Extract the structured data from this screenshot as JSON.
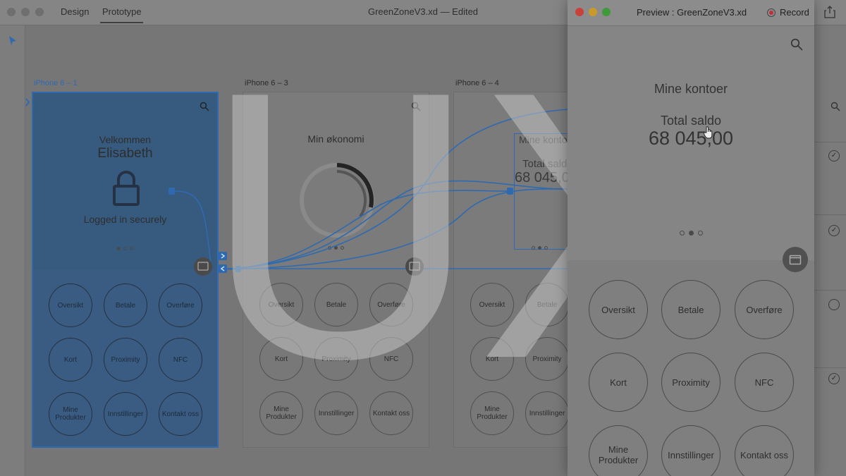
{
  "titlebar": {
    "tabs": [
      "Design",
      "Prototype"
    ],
    "active_tab": "Prototype",
    "document_title": "GreenZoneV3.xd — Edited"
  },
  "artboards": [
    {
      "label": "iPhone 6 – 1",
      "greeting": "Velkommen",
      "name": "Elisabeth",
      "status": "Logged in securely",
      "selected": true
    },
    {
      "label": "iPhone 6 – 3",
      "heading": "Min økonomi"
    },
    {
      "label": "iPhone 6 – 4",
      "heading": "Mine kontoer",
      "balance_label": "Total saldo",
      "balance_value": "68 045,00"
    }
  ],
  "menu_buttons": [
    [
      "Oversikt",
      "Betale",
      "Overføre"
    ],
    [
      "Kort",
      "Proximity",
      "NFC"
    ],
    [
      "Mine Produkter",
      "Innstillinger",
      "Kontakt oss"
    ]
  ],
  "overlay": {
    "text": "UX"
  },
  "preview": {
    "title": "Preview : GreenZoneV3.xd",
    "record_label": "Record",
    "heading": "Mine kontoer",
    "balance_label": "Total saldo",
    "balance_value": "68 045,00",
    "buttons": [
      [
        "Oversikt",
        "Betale",
        "Overføre"
      ],
      [
        "Kort",
        "Proximity",
        "NFC"
      ],
      [
        "Mine Produkter",
        "Innstillinger",
        "Kontakt oss"
      ]
    ]
  },
  "colors": {
    "selection": "#2f6ab0",
    "record": "#c0303a",
    "close": "#c8423a",
    "minimize": "#c99a2a",
    "zoom": "#3f9a3a"
  }
}
